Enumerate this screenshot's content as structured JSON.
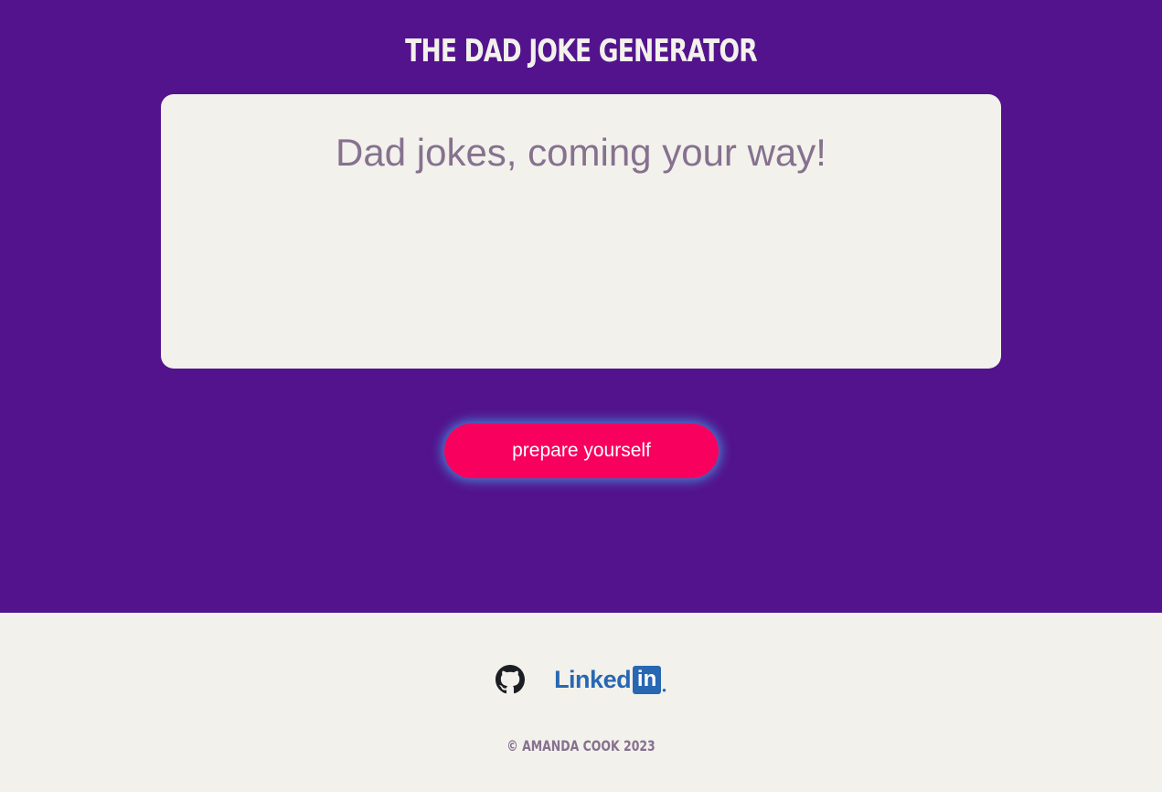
{
  "header": {
    "title": "THE DAD JOKE GENERATOR"
  },
  "joke_card": {
    "text": "Dad jokes, coming your way!"
  },
  "button": {
    "label": "prepare yourself"
  },
  "footer": {
    "links": [
      {
        "icon": "github-icon"
      },
      {
        "icon": "linkedin-logo",
        "text": "Linked",
        "box_text": "in"
      }
    ],
    "copyright": "© AMANDA COOK 2023"
  },
  "colors": {
    "background": "#53138d",
    "card": "#f2f1eb",
    "accent": "#f8005e",
    "glow": "#40a4ea",
    "muted_text": "#86718f",
    "linkedin": "#2867b2"
  }
}
